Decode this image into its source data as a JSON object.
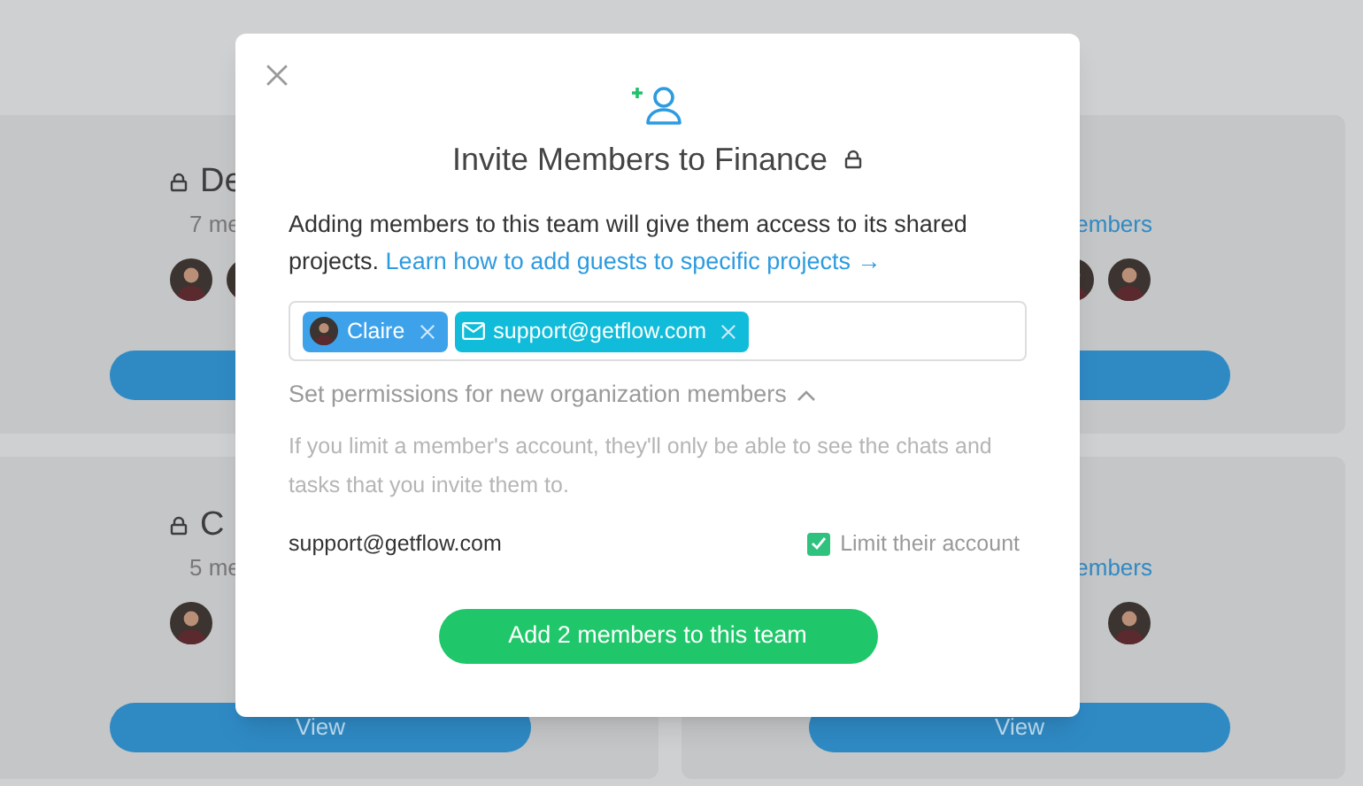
{
  "background_cards": [
    {
      "kind": "left",
      "title": "De",
      "member_count": "7 me"
    },
    {
      "kind": "right",
      "member_count": "embers"
    },
    {
      "kind": "left",
      "title": "C",
      "member_count": "5 me",
      "button_label": "View"
    },
    {
      "kind": "right",
      "member_count": "embers",
      "button_label": "View"
    }
  ],
  "modal": {
    "title": "Invite Members to Finance",
    "description": "Adding members to this team will give them access to its shared projects.",
    "link": "Learn how to add guests to specific projects →",
    "invitees": [
      {
        "kind": "user",
        "label": "Claire"
      },
      {
        "kind": "email",
        "label": "support@getflow.com"
      }
    ],
    "permissions": {
      "label": "Set permissions for new organization members",
      "expanded": true,
      "help": "If you limit a member's account, they'll only be able to see the chats and tasks that you invite them to.",
      "rows": [
        {
          "email": "support@getflow.com",
          "option": "Limit their account",
          "checked": true
        }
      ]
    },
    "submit": "Add 2 members to this team"
  }
}
